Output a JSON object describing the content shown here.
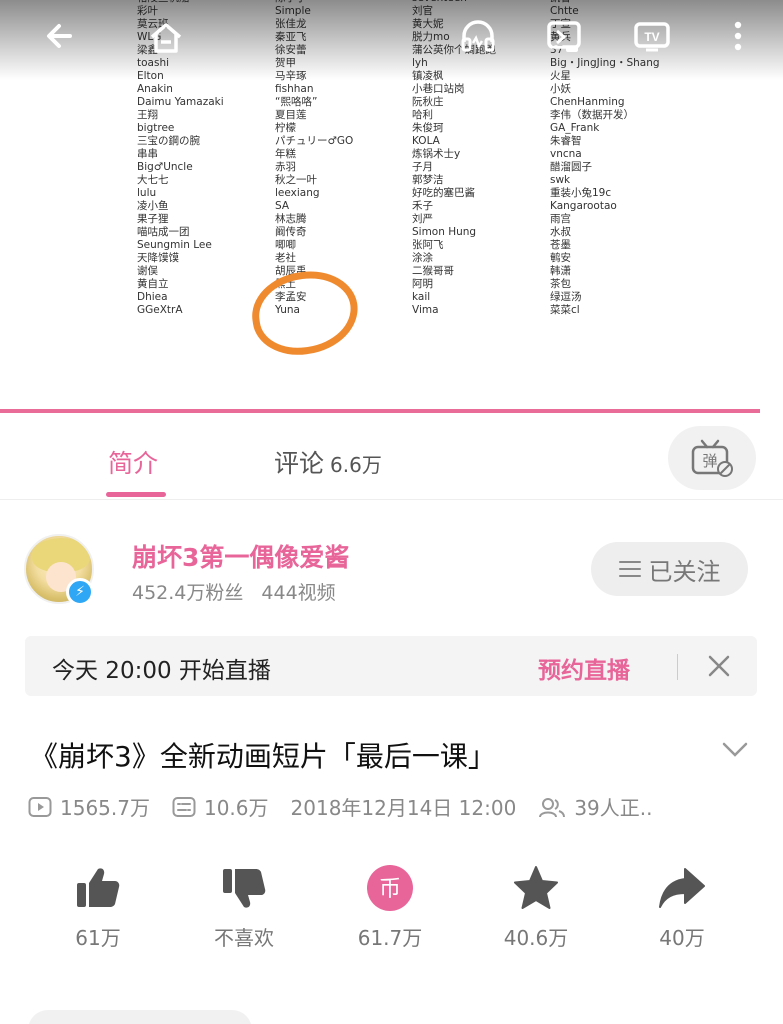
{
  "video": {
    "credits": [
      [
        "格陵兰帆船",
        "彩叶",
        "莫云班",
        "WLG",
        "梁鑫",
        "toashi",
        "Elton",
        "Anakin",
        "Daimu Yamazaki",
        "王翔",
        "bigtree",
        "三宝の鋼の腕",
        "串串",
        "Big♂Uncle",
        "大七七",
        "lulu",
        "凌小鱼",
        "果子狸",
        "喵咕成一团",
        "Seungmin Lee",
        "天降馍馍",
        "谢俣",
        "黄自立",
        "Dhiea",
        "GGeXtrA"
      ],
      [
        "陈宇宁",
        "Simple",
        "张佳龙",
        "秦亚飞",
        "徐安蕾",
        "贺甲",
        "马辛琢",
        "fishhan",
        "“熙咯咯”",
        "夏目莲",
        "柠檬",
        "パチュリー♂GO",
        "年糕",
        "赤羽",
        "秋之一叶",
        "leexiang",
        "SA",
        "林志腾",
        "阚传奇",
        "唧唧",
        "老社",
        "胡辰禹",
        "黑土",
        "李孟安",
        "Yuna"
      ],
      [
        "seventeen",
        "刘官",
        "黄大妮",
        "脱力mo",
        "蒲公英你个蜩跑跑",
        "lyh",
        "镇凌枫",
        "小巷口站岗",
        "阮秋庄",
        "哈利",
        "朱俊珂",
        "KOLA",
        "炼锅术士y",
        "子月",
        "郭梦洁",
        "好吃的塞巴酱",
        "禾子",
        "刘严",
        "Simon Hung",
        "张阿飞",
        "涂涂",
        "二猴哥哥",
        "阿明",
        "kail",
        "Vima"
      ],
      [
        "凯鲁",
        "Chtte",
        "丁宣",
        "黄兵",
        "37",
        "Big・JingJing・Shang",
        "火星",
        "小妖",
        "ChenHanming",
        "李伟（数据开发）",
        "GA_Frank",
        "朱睿智",
        "vncna",
        "醋溜圆子",
        "swk",
        "重装小兔19c",
        "Kangarootao",
        "雨宫",
        "水叔",
        "苍墨",
        "鹌安",
        "韩潇",
        "茶包",
        "绿逗汤",
        "菜菜cl"
      ]
    ],
    "progress": 0.97
  },
  "top_bar": {
    "icons": [
      "back-arrow-icon",
      "home-icon",
      "headphones-icon",
      "picture-in-picture-icon",
      "tv-cast-icon",
      "more-icon"
    ]
  },
  "tabs": {
    "intro": "简介",
    "comments": "评论",
    "comments_count": "6.6万",
    "danmaku_label": "弹"
  },
  "uploader": {
    "name": "崩坏3第一偶像爱酱",
    "followers": "452.4万粉丝",
    "videos": "444视频",
    "follow_label": "已关注"
  },
  "live": {
    "text": "今天 20:00 开始直播",
    "reserve_label": "预约直播"
  },
  "video_info": {
    "title": "《崩坏3》全新动画短片「最后一课」",
    "views": "1565.7万",
    "danmaku": "10.6万",
    "date": "2018年12月14日 12:00",
    "watching": "39人正.."
  },
  "actions": [
    {
      "name": "like",
      "label": "61万",
      "icon": "thumbs-up-icon"
    },
    {
      "name": "dislike",
      "label": "不喜欢",
      "icon": "thumbs-down-icon"
    },
    {
      "name": "coin",
      "label": "61.7万",
      "icon": "coin-icon",
      "coin_glyph": "币"
    },
    {
      "name": "favorite",
      "label": "40.6万",
      "icon": "star-icon"
    },
    {
      "name": "share",
      "label": "40万",
      "icon": "share-icon"
    }
  ],
  "colors": {
    "accent": "#e8659a",
    "annotation": "#f08a2e",
    "secondary_text": "#888888"
  }
}
